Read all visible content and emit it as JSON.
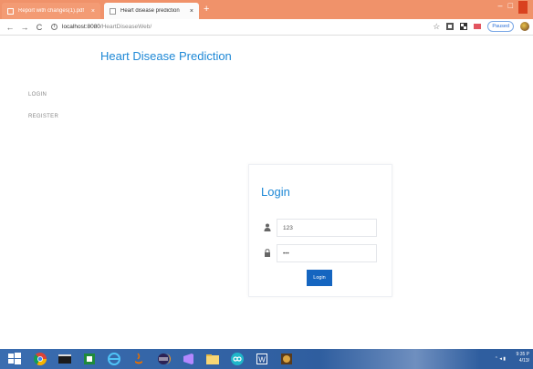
{
  "browser": {
    "tabs": [
      {
        "label": "Report with changes(1).pdf",
        "close": "×"
      },
      {
        "label": "Heart disease prediction",
        "close": "×"
      }
    ],
    "new_tab": "+",
    "window_controls": {
      "minimize": "–",
      "restore": "□"
    },
    "nav": {
      "back": "←",
      "forward": "→",
      "reload": "C"
    },
    "url_host": "localhost:8080",
    "url_path": "/HeartDiseaseWeb/",
    "star": "☆",
    "paused_label": "Paused"
  },
  "page": {
    "title": "Heart Disease Prediction",
    "sidebar": {
      "items": [
        {
          "label": "LOGIN"
        },
        {
          "label": "REGISTER"
        }
      ]
    },
    "login": {
      "title": "Login",
      "username_value": "123",
      "password_value": "•••",
      "button_label": "Login"
    }
  },
  "taskbar": {
    "apps": [
      "windows-start",
      "chrome",
      "terminal",
      "spreadsheet",
      "internet-explorer",
      "java",
      "eclipse",
      "visual-studio",
      "file-explorer",
      "media",
      "word",
      "game"
    ],
    "clock_time": "9:35 P",
    "clock_date": "4/13/"
  },
  "colors": {
    "accent": "#1e88d6",
    "button": "#1565c0",
    "tabstrip": "#f0926a",
    "taskbar": "#2e5d9e"
  }
}
